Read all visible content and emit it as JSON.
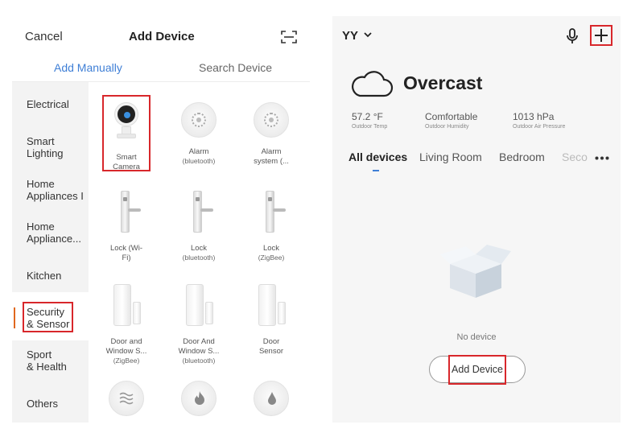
{
  "left_screen": {
    "nav": {
      "cancel_label": "Cancel",
      "title": "Add Device",
      "scan_icon": "scan-icon"
    },
    "tabs": {
      "manual": "Add Manually",
      "search": "Search Device",
      "active": "manual"
    },
    "categories": [
      {
        "label": "Electrical"
      },
      {
        "label": "Smart\nLighting"
      },
      {
        "label": "Home\nAppliances I"
      },
      {
        "label": "Home\nAppliance..."
      },
      {
        "label": "Kitchen"
      },
      {
        "label": "Security\n& Sensor"
      },
      {
        "label": "Sport\n& Health"
      },
      {
        "label": "Others"
      }
    ],
    "active_category": "Security & Sensor",
    "devices": [
      {
        "name": "Smart\nCamera",
        "sub": "",
        "icon": "camera-icon"
      },
      {
        "name": "Alarm",
        "sub": "(bluetooth)",
        "icon": "alarm-icon"
      },
      {
        "name": "Alarm\nsystem (...",
        "sub": "",
        "icon": "alarm-icon"
      },
      {
        "name": "Lock (Wi-\nFi)",
        "sub": "",
        "icon": "lock-icon"
      },
      {
        "name": "Lock",
        "sub": "(bluetooth)",
        "icon": "lock-icon"
      },
      {
        "name": "Lock",
        "sub": "(ZigBee)",
        "icon": "lock-icon"
      },
      {
        "name": "Door and\nWindow S...",
        "sub": "(ZigBee)",
        "icon": "door-sensor-icon"
      },
      {
        "name": "Door And\nWindow S...",
        "sub": "(bluetooth)",
        "icon": "door-sensor-icon"
      },
      {
        "name": "Door\nSensor",
        "sub": "",
        "icon": "door-sensor-icon"
      },
      {
        "name": "",
        "sub": "",
        "icon": "waves-icon"
      },
      {
        "name": "",
        "sub": "",
        "icon": "flame-icon"
      },
      {
        "name": "",
        "sub": "",
        "icon": "water-drop-icon"
      }
    ]
  },
  "right_screen": {
    "home_name": "YY",
    "weather": {
      "condition": "Overcast",
      "icon": "cloud-icon",
      "stats": [
        {
          "value": "57.2 °F",
          "label": "Outdoor Temp"
        },
        {
          "value": "Comfortable",
          "label": "Outdoor Humidity"
        },
        {
          "value": "1013 hPa",
          "label": "Outdoor Air Pressure"
        }
      ]
    },
    "rooms": [
      "All devices",
      "Living Room",
      "Bedroom",
      "Seco"
    ],
    "active_room": "All devices",
    "empty_text": "No device",
    "add_device_label": "Add Device"
  },
  "highlight_color": "#d8272b",
  "accent_color": "#3f7fd6"
}
